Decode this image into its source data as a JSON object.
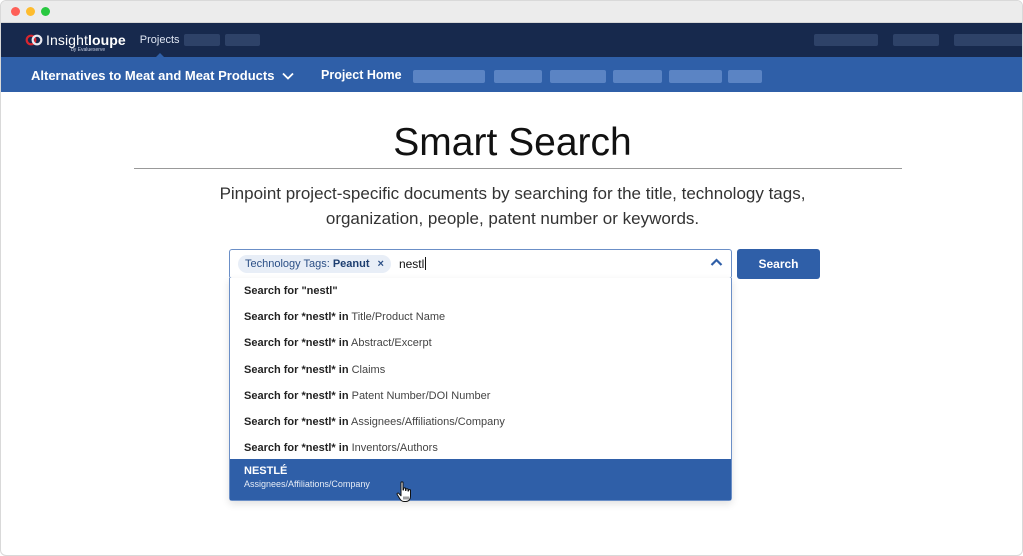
{
  "app": {
    "logo_light": "Insight",
    "logo_bold": "loupe",
    "logo_sub": "by Evalueserve",
    "nav_projects": "Projects"
  },
  "subnav": {
    "project_title": "Alternatives to Meat and Meat Products",
    "project_home": "Project Home"
  },
  "page": {
    "title": "Smart Search",
    "subtitle": "Pinpoint project-specific documents by searching for the title, technology tags, organization, people, patent number or keywords."
  },
  "search": {
    "chip_key": "Technology Tags:",
    "chip_value": "Peanut",
    "chip_remove": "×",
    "query": "nestl",
    "button_label": "Search"
  },
  "dropdown": {
    "options": [
      {
        "bold": "Search for \"nestl\"",
        "rest": ""
      },
      {
        "bold": "Search for *nestl* in",
        "rest": " Title/Product Name"
      },
      {
        "bold": "Search for *nestl* in",
        "rest": " Abstract/Excerpt"
      },
      {
        "bold": "Search for *nestl* in",
        "rest": " Claims"
      },
      {
        "bold": "Search for *nestl* in",
        "rest": " Patent Number/DOI Number"
      },
      {
        "bold": "Search for *nestl* in",
        "rest": " Assignees/Affiliations/Company"
      },
      {
        "bold": "Search for *nestl* in",
        "rest": " Inventors/Authors"
      }
    ],
    "highlighted": {
      "title": "NESTLÉ",
      "subtitle": "Assignees/Affiliations/Company"
    }
  },
  "colors": {
    "topnav": "#17294d",
    "subnav": "#2f5fa8",
    "accent": "#2f5fa8",
    "logo_red": "#d9262e"
  },
  "icons": {
    "project_dropdown": "chevron-down-icon",
    "search_collapse": "chevron-up-icon",
    "chip_remove": "close-icon",
    "pointer": "hand-pointer-icon"
  }
}
